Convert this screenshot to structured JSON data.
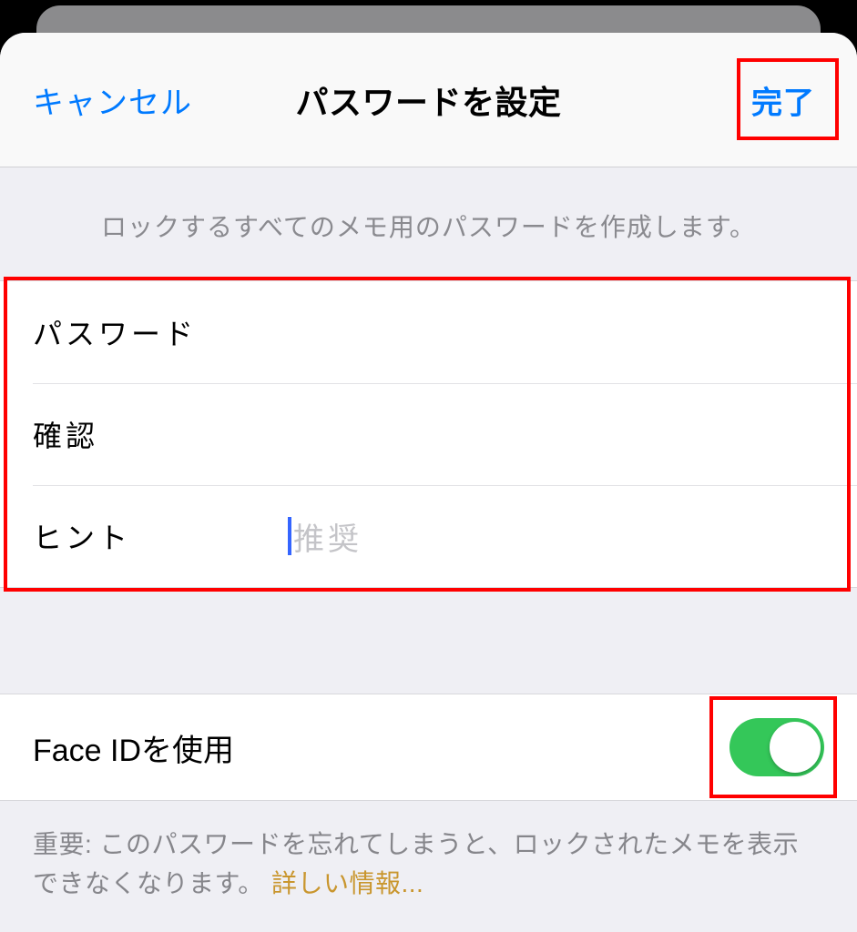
{
  "nav": {
    "cancel": "キャンセル",
    "title": "パスワードを設定",
    "done": "完了"
  },
  "desc": "ロックするすべてのメモ用のパスワードを作成します。",
  "fields": {
    "password_label": "パスワード",
    "verify_label": "確認",
    "hint_label": "ヒント",
    "hint_placeholder": "推奨"
  },
  "faceid": {
    "label": "Face IDを使用",
    "enabled": true
  },
  "footer": {
    "prefix": "重要: このパスワードを忘れてしまうと、ロックされたメモを表示できなくなります。 ",
    "link": "詳しい情報..."
  }
}
